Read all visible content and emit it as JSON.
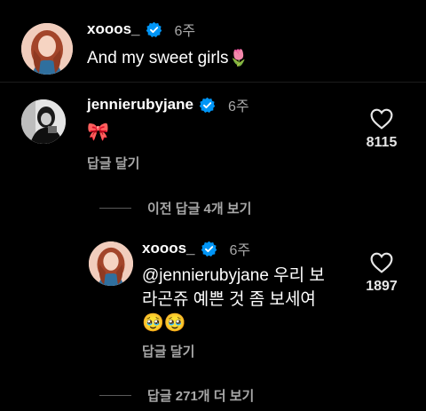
{
  "comments": [
    {
      "username": "xooos_",
      "time": "6주",
      "text": "And my sweet girls",
      "emoji": "🌷",
      "avatar_icon": "illustrated-girl-avatar"
    },
    {
      "username": "jennierubyjane",
      "time": "6주",
      "text": "🎀",
      "reply_label": "답글 달기",
      "likes": "8115",
      "avatar_icon": "photo-avatar"
    }
  ],
  "view_previous_replies": "이전 답글 4개 보기",
  "reply": {
    "username": "xooos_",
    "time": "6주",
    "text_line1": "@jennierubyjane 우리 보",
    "text_line2": "라곤쥬 예쁜 것 좀 보세여",
    "emojis": "🥹🥹",
    "reply_label": "답글 달기",
    "likes": "1897"
  },
  "view_more_replies": "답글 271개 더 보기",
  "colors": {
    "background": "#000000",
    "text": "#ffffff",
    "muted": "#a8a8a8",
    "verified": "#0095f6"
  }
}
